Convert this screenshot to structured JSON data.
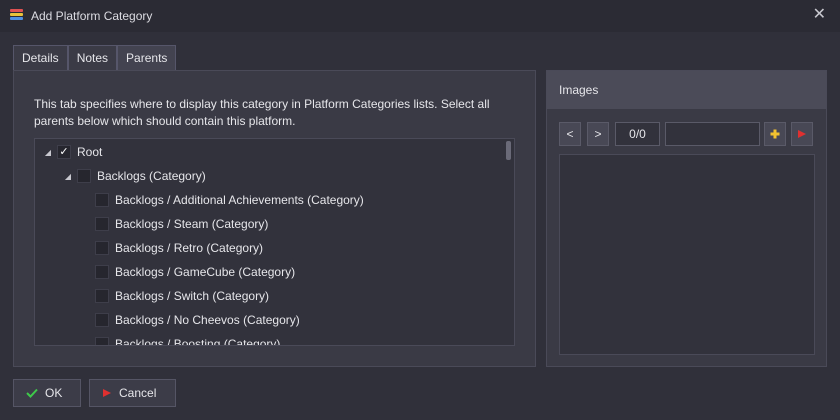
{
  "window": {
    "title": "Add Platform Category",
    "close_glyph": "✕",
    "icon": "app-stripes-icon",
    "icon_colors": [
      "#e05252",
      "#e8c23a",
      "#4f8fe0"
    ]
  },
  "tabs": [
    {
      "label": "Details",
      "active": false
    },
    {
      "label": "Notes",
      "active": false
    },
    {
      "label": "Parents",
      "active": true
    }
  ],
  "parents": {
    "description": "This tab specifies where to display this category in Platform Categories lists. Select all parents below which should contain this platform.",
    "tree": [
      {
        "label": "Root",
        "checked": true,
        "expanded": true
      },
      {
        "label": "Backlogs (Category)",
        "checked": false,
        "expanded": true
      },
      {
        "label": "Backlogs / Additional Achievements (Category)",
        "checked": false
      },
      {
        "label": "Backlogs / Steam (Category)",
        "checked": false
      },
      {
        "label": "Backlogs / Retro (Category)",
        "checked": false
      },
      {
        "label": "Backlogs / GameCube (Category)",
        "checked": false
      },
      {
        "label": "Backlogs / Switch (Category)",
        "checked": false
      },
      {
        "label": "Backlogs / No Cheevos (Category)",
        "checked": false
      },
      {
        "label": "Backlogs / Boosting (Category)",
        "checked": false
      }
    ],
    "expander_glyph": "◢",
    "check_glyph": "✓"
  },
  "images": {
    "header": "Images",
    "prev_label": "<",
    "next_label": ">",
    "counter": "0/0",
    "add_icon": "plus-icon",
    "add_color": "#f2c230",
    "remove_icon": "remove-icon",
    "remove_color": "#e03030"
  },
  "buttons": {
    "ok_label": "OK",
    "ok_color": "#3ec94a",
    "cancel_label": "Cancel",
    "cancel_color": "#e03030"
  }
}
